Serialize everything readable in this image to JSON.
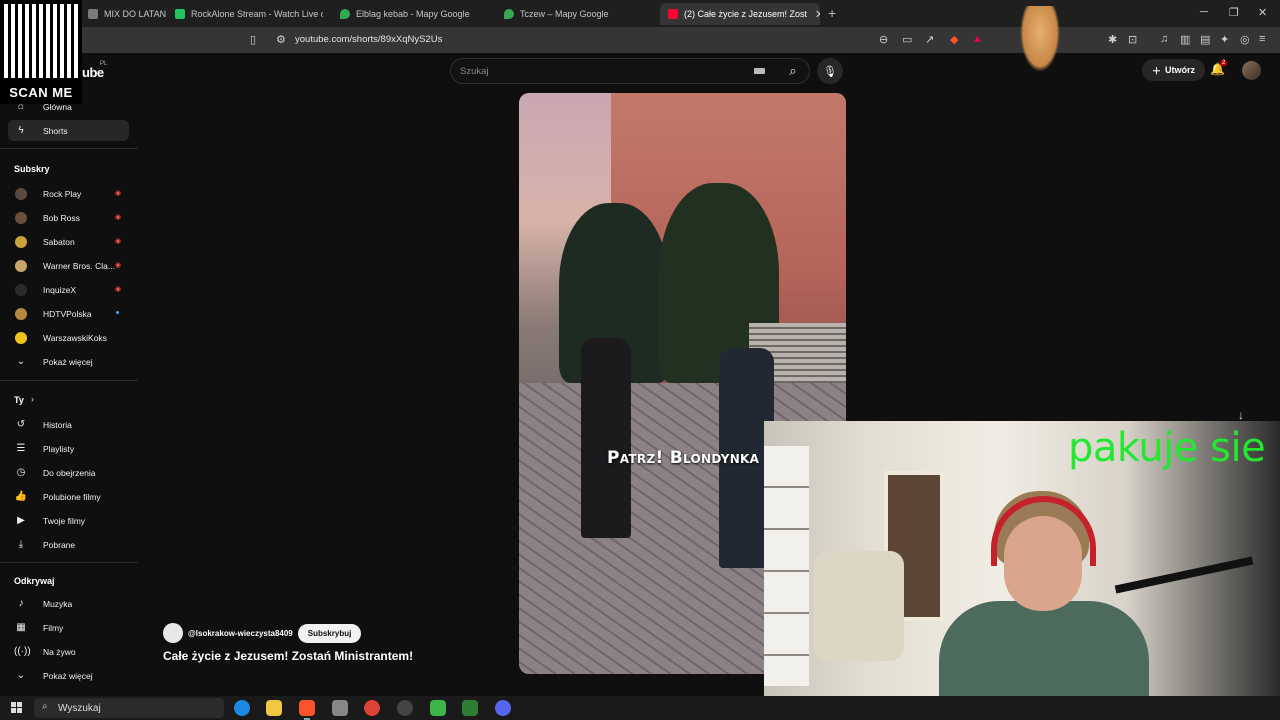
{
  "browser": {
    "tabs": [
      {
        "label": "MIX DO LATANIA",
        "color": "#7a7a7a"
      },
      {
        "label": "RockAlone Stream - Watch Live o",
        "color": "#22c55e"
      },
      {
        "label": "Elblag kebab - Mapy Google",
        "color": "#34a853"
      },
      {
        "label": "Tczew – Mapy Google",
        "color": "#34a853"
      },
      {
        "label": "(2) Całe życie z Jezusem! Zost",
        "color": "#ff0033",
        "active": true
      }
    ],
    "url": "youtube.com/shorts/89xXqNyS2Us"
  },
  "youtube": {
    "logo": "ube",
    "logo_region": "PL",
    "search_placeholder": "Szukaj",
    "create_label": "Utwórz",
    "notifications_count": "2"
  },
  "sidebar": {
    "top_items": [
      {
        "label": "Główna",
        "icon": "home-icon"
      },
      {
        "label": "Shorts",
        "icon": "shorts-icon",
        "active": true
      }
    ],
    "subscriptions_heading": "Subskry",
    "subscriptions": [
      {
        "label": "Rock Play",
        "live": true,
        "color": "#5a4a3e"
      },
      {
        "label": "Bob Ross",
        "live": true,
        "color": "#6b4f3a"
      },
      {
        "label": "Sabaton",
        "live": true,
        "color": "#c8a23c"
      },
      {
        "label": "Warner Bros. Cla...",
        "live": true,
        "color": "#c9a56b"
      },
      {
        "label": "InquizeX",
        "live": true,
        "color": "#2b2b2b"
      },
      {
        "label": "HDTVPolska",
        "live": false,
        "color": "#b7893e"
      },
      {
        "label": "WarszawskiKoks",
        "live": false,
        "color": "#f1c21b"
      }
    ],
    "show_more_1": "Pokaż więcej",
    "you_heading": "Ty",
    "you_items": [
      {
        "label": "Historia",
        "icon": "history-icon"
      },
      {
        "label": "Playlisty",
        "icon": "playlist-icon"
      },
      {
        "label": "Do obejrzenia",
        "icon": "clock-icon"
      },
      {
        "label": "Polubione filmy",
        "icon": "thumb-up-icon"
      },
      {
        "label": "Twoje filmy",
        "icon": "video-icon"
      },
      {
        "label": "Pobrane",
        "icon": "download-icon"
      }
    ],
    "explore_heading": "Odkrywaj",
    "explore_items": [
      {
        "label": "Muzyka",
        "icon": "music-icon"
      },
      {
        "label": "Filmy",
        "icon": "film-icon"
      },
      {
        "label": "Na żywo",
        "icon": "live-icon"
      }
    ],
    "show_more_2": "Pokaż więcej"
  },
  "short": {
    "caption": "Patrz! Blondynka",
    "channel": "@lsokrakow-wieczysta8409",
    "subscribe_label": "Subskrybuj",
    "title": "Całe życie z Jezusem! Zostań Ministrantem!"
  },
  "overlay": {
    "stream_text": "pakuje sie",
    "qr_label": "SCAN ME"
  },
  "taskbar": {
    "search_placeholder": "Wyszukaj"
  }
}
